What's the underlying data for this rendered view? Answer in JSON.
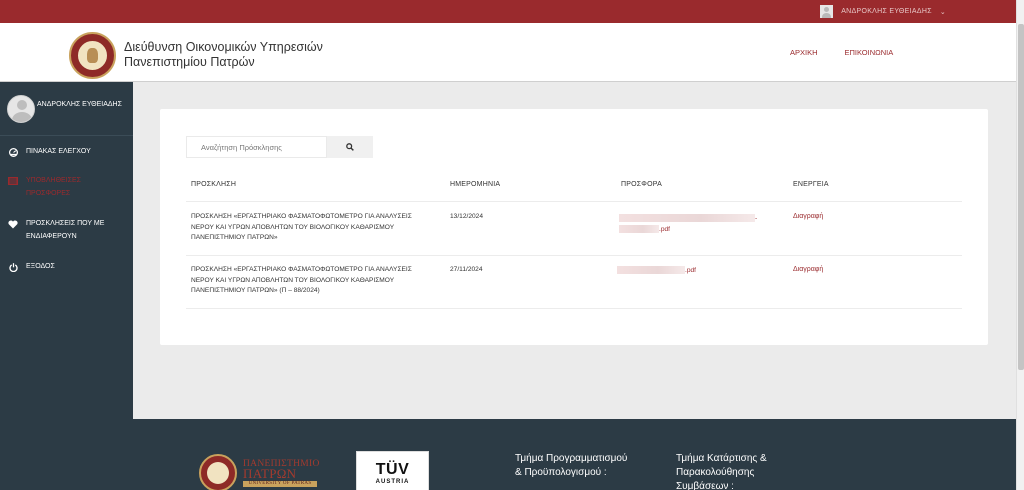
{
  "topbar": {
    "user_name": "ΑΝΔΡΟΚΛΗΣ ΕΥΘΕΙΑΔΗΣ",
    "caret": "⌄"
  },
  "header": {
    "title_line1": "Διεύθυνση Οικονομικών Υπηρεσιών",
    "title_line2": "Πανεπιστημίου Πατρών",
    "nav": [
      "ΑΡΧΙΚΗ",
      "ΕΠΙΚΟΙΝΩΝΙΑ"
    ]
  },
  "sidebar": {
    "user_name": "ΑΝΔΡΟΚΛΗΣ ΕΥΘΕΙΑΔΗΣ",
    "items": [
      {
        "label": "ΠΙΝΑΚΑΣ ΕΛΕΓΧΟΥ",
        "icon": "dashboard-icon"
      },
      {
        "label": "ΥΠΟΒΛΗΘΕΙΣΕΣ ΠΡΟΣΦΟΡΕΣ",
        "icon": "list-icon",
        "active": true
      },
      {
        "label": "ΠΡΟΣΚΛΗΣΕΙΣ ΠΟΥ ΜΕ ΕΝΔΙΑΦΕΡΟΥΝ",
        "icon": "heart-icon"
      },
      {
        "label": "ΕΞΟΔΟΣ",
        "icon": "power-icon"
      }
    ]
  },
  "search": {
    "placeholder": "Αναζήτηση Πρόσκλησης"
  },
  "table": {
    "headers": [
      "ΠΡΟΣΚΛΗΣΗ",
      "ΗΜΕΡΟΜΗΝΙΑ",
      "ΠΡΟΣΦΟΡΑ",
      "ΕΝΕΡΓΕΙΑ"
    ],
    "rows": [
      {
        "title": "ΠΡΟΣΚΛΗΣΗ «ΕΡΓΑΣΤΗΡΙΑΚΟ ΦΑΣΜΑΤΟΦΩΤΟΜΕΤΡΟ ΓΙΑ ΑΝΑΛΥΣΕΙΣ ΝΕΡΟΥ ΚΑΙ ΥΓΡΩΝ ΑΠΟΒΛΗΤΩΝ ΤΟΥ ΒΙΟΛΟΓΙΚΟΥ ΚΑΘΑΡΙΣΜΟΥ ΠΑΝΕΠΙΣΤΗΜΙΟΥ ΠΑΤΡΩΝ»",
        "date": "13/12/2024",
        "offer_line1_suffix": "-",
        "offer_line2_suffix": ".pdf",
        "action": "Διαγραφή"
      },
      {
        "title": "ΠΡΟΣΚΛΗΣΗ «ΕΡΓΑΣΤΗΡΙΑΚΟ ΦΑΣΜΑΤΟΦΩΤΟΜΕΤΡΟ ΓΙΑ ΑΝΑΛΥΣΕΙΣ ΝΕΡΟΥ ΚΑΙ ΥΓΡΩΝ ΑΠΟΒΛΗΤΩΝ ΤΟΥ ΒΙΟΛΟΓΙΚΟΥ ΚΑΘΑΡΙΣΜΟΥ ΠΑΝΕΠΙΣΤΗΜΙΟΥ ΠΑΤΡΩΝ» (Π – 88/2024)",
        "date": "27/11/2024",
        "offer_line1_suffix": ".pdf",
        "action": "Διαγραφή"
      }
    ]
  },
  "footer": {
    "uni_logo_line1": "ΠΑΝΕΠΙΣΤΗΜΙΟ",
    "uni_logo_line2": "ΠΑΤΡΩΝ",
    "uni_logo_sub": "UNIVERSITY OF PATRAS",
    "cert_brand": "TÜV",
    "cert_sub": "AUSTRIA",
    "col1_line1": "Τμήμα Προγραμματισμού",
    "col1_line2": "& Προϋπολογισμού :",
    "col2_line1": "Τμήμα Κατάρτισης &",
    "col2_line2": "Παρακολούθησης",
    "col2_line3": "Συμβάσεων :"
  },
  "colors": {
    "brand": "#9a2a2d",
    "sidebar": "#2c3b45",
    "background": "#ebebeb"
  }
}
